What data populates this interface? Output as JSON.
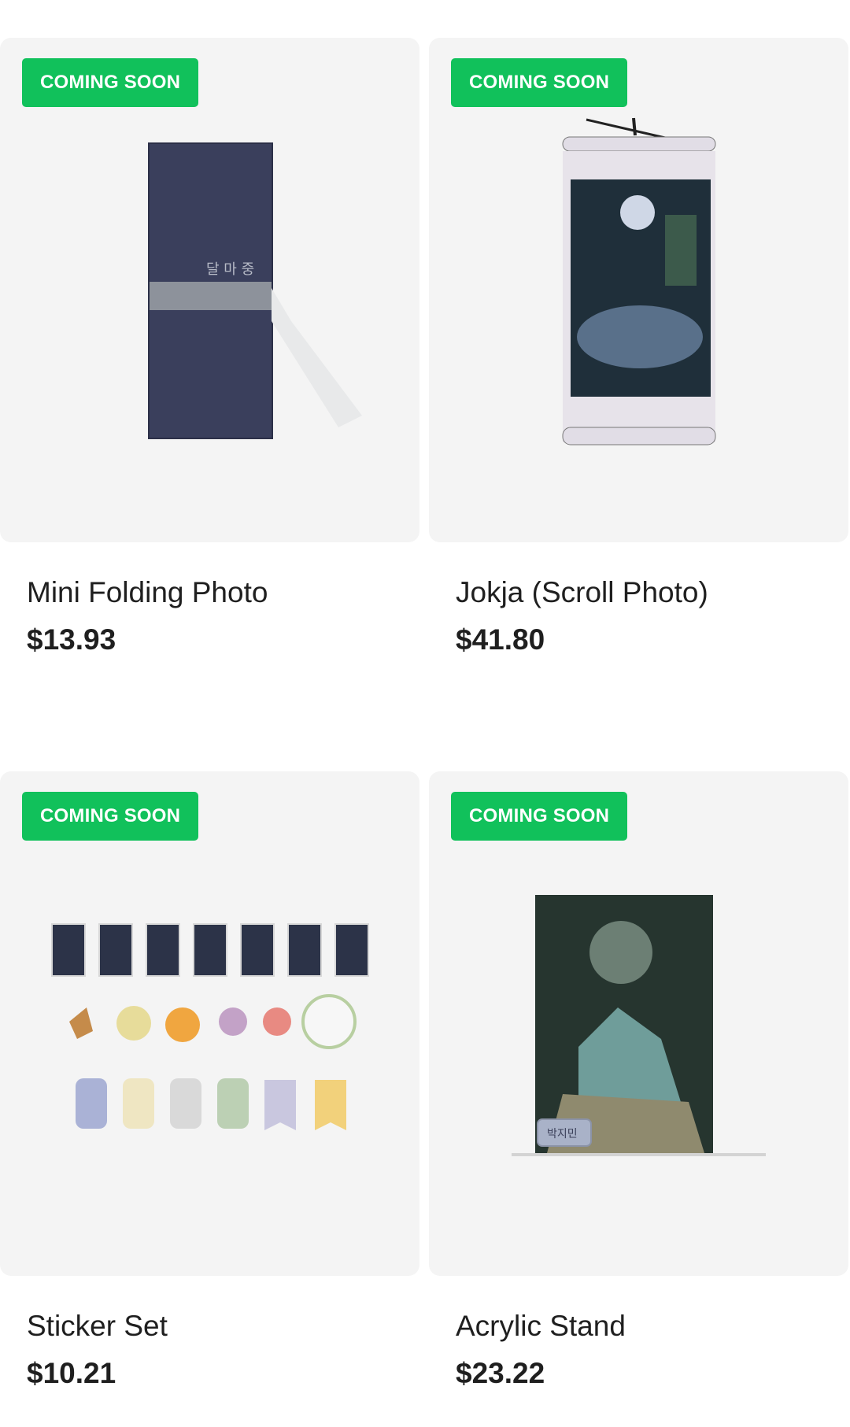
{
  "products": [
    {
      "badge": "COMING SOON",
      "name": "Mini Folding Photo",
      "price": "$13.93"
    },
    {
      "badge": "COMING SOON",
      "name": "Jokja (Scroll Photo)",
      "price": "$41.80"
    },
    {
      "badge": "COMING SOON",
      "name": "Sticker Set",
      "price": "$10.21"
    },
    {
      "badge": "COMING SOON",
      "name": "Acrylic Stand",
      "price": "$23.22"
    }
  ],
  "colors": {
    "badge": "#11c15b",
    "card_bg": "#f4f4f4",
    "text": "#1f1f1f"
  }
}
